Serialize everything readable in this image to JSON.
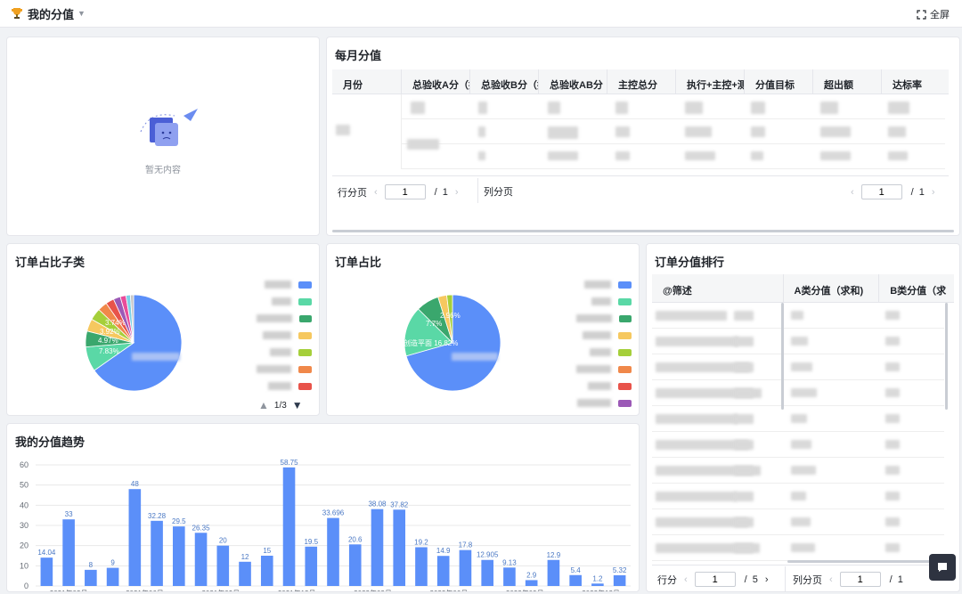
{
  "header": {
    "title": "我的分值",
    "fullscreen_label": "全屏"
  },
  "empty_card": {
    "text": "暂无内容"
  },
  "monthly": {
    "title": "每月分值",
    "columns": [
      "月份",
      "总验收A分（执",
      "总验收B分（执",
      "总验收AB分（",
      "主控总分",
      "执行+主控+测",
      "分值目标",
      "超出额",
      "达标率"
    ],
    "row_pager_label": "行分页",
    "col_pager_label": "列分页",
    "row_page": "1",
    "row_total": "1",
    "col_page": "1",
    "col_total": "1",
    "page_sep": "/"
  },
  "sub_pie": {
    "title": "订单占比子类",
    "labels": [
      "7.83%",
      "4.97%",
      "3.92%",
      "3.74%"
    ],
    "pager": "1/3",
    "legend_colors": [
      "#5b8ff9",
      "#5ad8a6",
      "#3aa76d",
      "#f6c85f",
      "#a5cf3a",
      "#f0884a",
      "#e8534a"
    ]
  },
  "order_pie": {
    "title": "订单占比",
    "labels": [
      "7.7%",
      "2.96%",
      "16.82%"
    ],
    "label_prefix": "创造平面",
    "legend_colors": [
      "#5b8ff9",
      "#5ad8a6",
      "#3aa76d",
      "#f6c85f",
      "#a5cf3a",
      "#f0884a",
      "#e8534a",
      "#9b59b6"
    ]
  },
  "ranking": {
    "title": "订单分值排行",
    "columns": [
      "@筛述",
      "A类分值（求和)",
      "B类分值（求"
    ],
    "row_pager_label": "行分",
    "row_page": "1",
    "row_total": "5",
    "col_pager_label": "列分页",
    "col_page": "1",
    "col_total": "1",
    "page_sep": "/"
  },
  "trend": {
    "title": "我的分值趋势",
    "x_tick_labels": [
      "2021年03月",
      "2021年06月",
      "2021年09月",
      "2021年12月",
      "2022年03月",
      "2022年06月",
      "2022年09月",
      "2022年12月"
    ]
  },
  "chart_data": {
    "type": "bar",
    "title": "我的分值趋势",
    "ylim": [
      0,
      60
    ],
    "y_ticks": [
      0,
      10,
      20,
      30,
      40,
      50,
      60
    ],
    "values": [
      14.04,
      33,
      8,
      9,
      48,
      32.28,
      29.5,
      26.35,
      20,
      12,
      15,
      58.75,
      19.5,
      33.696,
      20.6,
      38.08,
      37.82,
      19.2,
      14.9,
      17.8,
      12.905,
      9.13,
      2.9,
      12.9,
      5.4,
      1.2,
      5.32
    ],
    "value_labels": [
      "14.04",
      "33",
      "8",
      "9",
      "48",
      "32.28",
      "29.5",
      "26.35",
      "20",
      "12",
      "15",
      "58.75",
      "19.5",
      "33.696",
      "20.6",
      "38.08",
      "37.82",
      "19.2",
      "14.9",
      "17.8",
      "12.905",
      "9.13",
      "2.9",
      "12.9",
      "5.4",
      "1.2",
      "5.32"
    ],
    "bar_color": "#5b8ff9",
    "grid": true
  },
  "pies": {
    "sub_slices": [
      {
        "value": 61,
        "color": "#5b8ff9"
      },
      {
        "value": 7.83,
        "color": "#5ad8a6"
      },
      {
        "value": 4.97,
        "color": "#3aa76d"
      },
      {
        "value": 3.92,
        "color": "#f6c85f"
      },
      {
        "value": 3.74,
        "color": "#a5cf3a"
      },
      {
        "value": 3.0,
        "color": "#f0884a"
      },
      {
        "value": 2.6,
        "color": "#e8534a"
      },
      {
        "value": 2.2,
        "color": "#9b59b6"
      },
      {
        "value": 1.8,
        "color": "#e84c9a"
      },
      {
        "value": 1.4,
        "color": "#7bd1e8"
      },
      {
        "value": 1.0,
        "color": "#c7c7c7"
      }
    ],
    "order_slices": [
      {
        "value": 70.6,
        "color": "#5b8ff9"
      },
      {
        "value": 16.82,
        "color": "#5ad8a6"
      },
      {
        "value": 7.7,
        "color": "#3aa76d"
      },
      {
        "value": 2.96,
        "color": "#f6c85f"
      },
      {
        "value": 1.92,
        "color": "#a5cf3a"
      }
    ]
  }
}
